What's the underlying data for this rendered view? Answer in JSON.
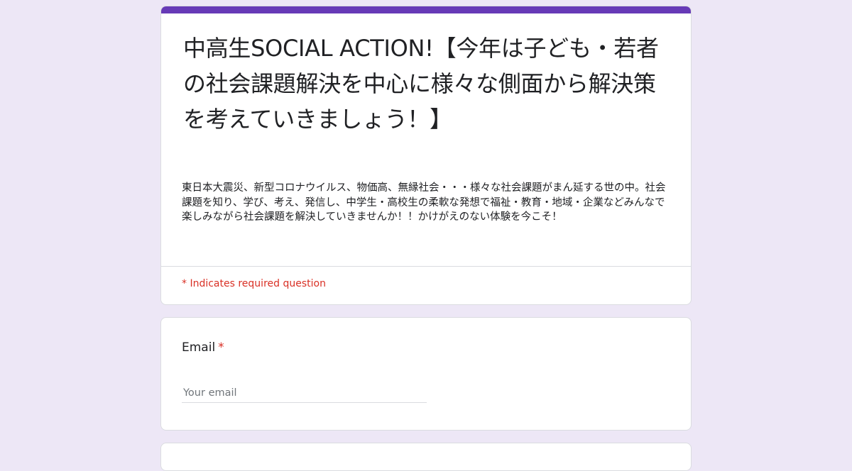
{
  "form": {
    "title": "中高生SOCIAL ACTION!【今年は子ども・若者の社会課題解決を中心に様々な側面から解決策を考えていきましょう！】",
    "description": "東日本大震災、新型コロナウイルス、物価高、無縁社会・・・様々な社会課題がまん延する世の中。社会課題を知り、学び、考え、発信し、中学生・高校生の柔軟な発想で福祉・教育・地域・企業などみんなで楽しみながら社会課題を解決していきませんか！！かけがえのない体験を今こそ！",
    "required_note": "* Indicates required question"
  },
  "questions": {
    "email": {
      "label": "Email",
      "required_mark": "*",
      "placeholder": "Your email"
    }
  },
  "colors": {
    "page_background": "#ede7f6",
    "accent": "#673ab7",
    "required": "#d93025"
  }
}
